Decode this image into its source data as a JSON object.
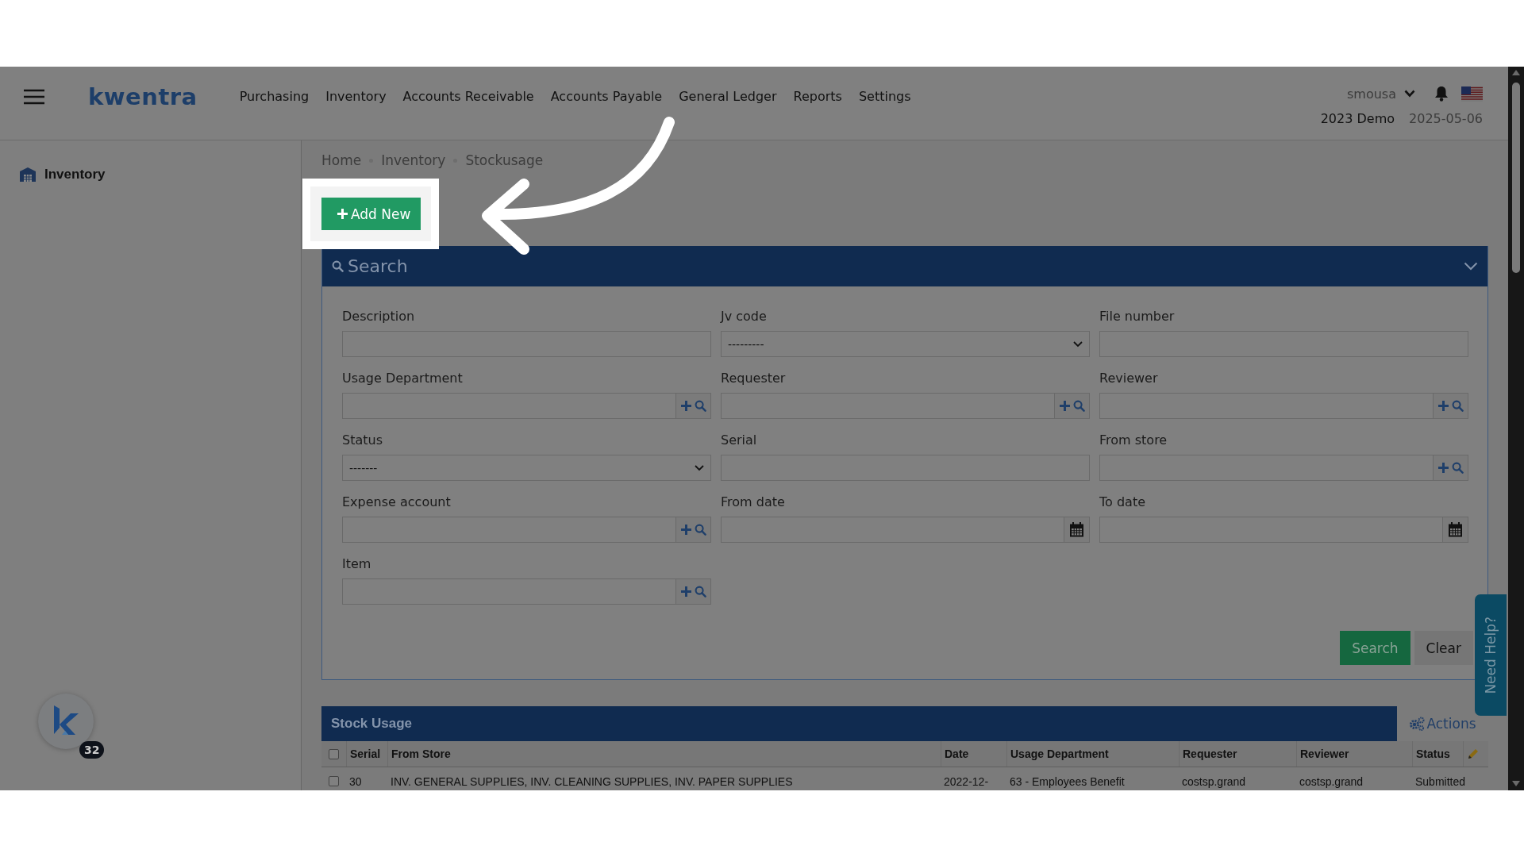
{
  "header": {
    "logo": "kwentra",
    "nav": [
      "Purchasing",
      "Inventory",
      "Accounts Receivable",
      "Accounts Payable",
      "General Ledger",
      "Reports",
      "Settings"
    ],
    "user": "smousa",
    "company": "2023 Demo",
    "date": "2025-05-06"
  },
  "sidebar": {
    "items": [
      {
        "label": "Inventory"
      }
    ]
  },
  "breadcrumb": [
    "Home",
    "Inventory",
    "Stockusage"
  ],
  "add_button": "Add New",
  "search_panel": {
    "title": "Search",
    "fields": [
      {
        "label": "Description",
        "kind": "text"
      },
      {
        "label": "Jv code",
        "kind": "select",
        "value": "---------"
      },
      {
        "label": "File number",
        "kind": "text"
      },
      {
        "label": "Usage Department",
        "kind": "lookup"
      },
      {
        "label": "Requester",
        "kind": "lookup"
      },
      {
        "label": "Reviewer",
        "kind": "lookup"
      },
      {
        "label": "Status",
        "kind": "select",
        "value": "-------"
      },
      {
        "label": "Serial",
        "kind": "text"
      },
      {
        "label": "From store",
        "kind": "lookup"
      },
      {
        "label": "Expense account",
        "kind": "lookup"
      },
      {
        "label": "From date",
        "kind": "date"
      },
      {
        "label": "To date",
        "kind": "date"
      },
      {
        "label": "Item",
        "kind": "lookup"
      }
    ],
    "buttons": [
      {
        "label": "Search",
        "kind": "primary"
      },
      {
        "label": "Clear",
        "kind": "secondary"
      }
    ]
  },
  "table": {
    "title": "Stock Usage",
    "actions": "Actions",
    "select_all": false,
    "columns": [
      "Serial",
      "From Store",
      "Date",
      "Usage Department",
      "Requester",
      "Reviewer",
      "Status"
    ],
    "rows": [
      {
        "checked": false,
        "cells": [
          "30",
          "INV. GENERAL SUPPLIES, INV. CLEANING SUPPLIES, INV. PAPER SUPPLIES",
          "2022-12-",
          "63 - Employees Benefit",
          "costsp.grand",
          "costsp.grand",
          "Submitted"
        ]
      }
    ]
  },
  "help_tab": "Need Help?",
  "chat_badge": "32"
}
